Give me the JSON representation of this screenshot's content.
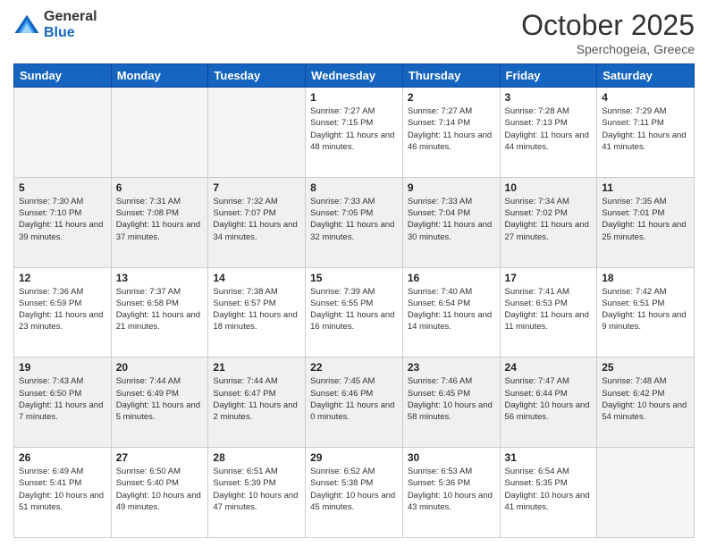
{
  "header": {
    "logo_general": "General",
    "logo_blue": "Blue",
    "month_title": "October 2025",
    "location": "Sperchogeia, Greece"
  },
  "days_of_week": [
    "Sunday",
    "Monday",
    "Tuesday",
    "Wednesday",
    "Thursday",
    "Friday",
    "Saturday"
  ],
  "weeks": [
    [
      {
        "day": "",
        "empty": true
      },
      {
        "day": "",
        "empty": true
      },
      {
        "day": "",
        "empty": true
      },
      {
        "day": "1",
        "sunrise": "7:27 AM",
        "sunset": "7:15 PM",
        "daylight": "11 hours and 48 minutes."
      },
      {
        "day": "2",
        "sunrise": "7:27 AM",
        "sunset": "7:14 PM",
        "daylight": "11 hours and 46 minutes."
      },
      {
        "day": "3",
        "sunrise": "7:28 AM",
        "sunset": "7:13 PM",
        "daylight": "11 hours and 44 minutes."
      },
      {
        "day": "4",
        "sunrise": "7:29 AM",
        "sunset": "7:11 PM",
        "daylight": "11 hours and 41 minutes."
      }
    ],
    [
      {
        "day": "5",
        "sunrise": "7:30 AM",
        "sunset": "7:10 PM",
        "daylight": "11 hours and 39 minutes."
      },
      {
        "day": "6",
        "sunrise": "7:31 AM",
        "sunset": "7:08 PM",
        "daylight": "11 hours and 37 minutes."
      },
      {
        "day": "7",
        "sunrise": "7:32 AM",
        "sunset": "7:07 PM",
        "daylight": "11 hours and 34 minutes."
      },
      {
        "day": "8",
        "sunrise": "7:33 AM",
        "sunset": "7:05 PM",
        "daylight": "11 hours and 32 minutes."
      },
      {
        "day": "9",
        "sunrise": "7:33 AM",
        "sunset": "7:04 PM",
        "daylight": "11 hours and 30 minutes."
      },
      {
        "day": "10",
        "sunrise": "7:34 AM",
        "sunset": "7:02 PM",
        "daylight": "11 hours and 27 minutes."
      },
      {
        "day": "11",
        "sunrise": "7:35 AM",
        "sunset": "7:01 PM",
        "daylight": "11 hours and 25 minutes."
      }
    ],
    [
      {
        "day": "12",
        "sunrise": "7:36 AM",
        "sunset": "6:59 PM",
        "daylight": "11 hours and 23 minutes."
      },
      {
        "day": "13",
        "sunrise": "7:37 AM",
        "sunset": "6:58 PM",
        "daylight": "11 hours and 21 minutes."
      },
      {
        "day": "14",
        "sunrise": "7:38 AM",
        "sunset": "6:57 PM",
        "daylight": "11 hours and 18 minutes."
      },
      {
        "day": "15",
        "sunrise": "7:39 AM",
        "sunset": "6:55 PM",
        "daylight": "11 hours and 16 minutes."
      },
      {
        "day": "16",
        "sunrise": "7:40 AM",
        "sunset": "6:54 PM",
        "daylight": "11 hours and 14 minutes."
      },
      {
        "day": "17",
        "sunrise": "7:41 AM",
        "sunset": "6:53 PM",
        "daylight": "11 hours and 11 minutes."
      },
      {
        "day": "18",
        "sunrise": "7:42 AM",
        "sunset": "6:51 PM",
        "daylight": "11 hours and 9 minutes."
      }
    ],
    [
      {
        "day": "19",
        "sunrise": "7:43 AM",
        "sunset": "6:50 PM",
        "daylight": "11 hours and 7 minutes."
      },
      {
        "day": "20",
        "sunrise": "7:44 AM",
        "sunset": "6:49 PM",
        "daylight": "11 hours and 5 minutes."
      },
      {
        "day": "21",
        "sunrise": "7:44 AM",
        "sunset": "6:47 PM",
        "daylight": "11 hours and 2 minutes."
      },
      {
        "day": "22",
        "sunrise": "7:45 AM",
        "sunset": "6:46 PM",
        "daylight": "11 hours and 0 minutes."
      },
      {
        "day": "23",
        "sunrise": "7:46 AM",
        "sunset": "6:45 PM",
        "daylight": "10 hours and 58 minutes."
      },
      {
        "day": "24",
        "sunrise": "7:47 AM",
        "sunset": "6:44 PM",
        "daylight": "10 hours and 56 minutes."
      },
      {
        "day": "25",
        "sunrise": "7:48 AM",
        "sunset": "6:42 PM",
        "daylight": "10 hours and 54 minutes."
      }
    ],
    [
      {
        "day": "26",
        "sunrise": "6:49 AM",
        "sunset": "5:41 PM",
        "daylight": "10 hours and 51 minutes."
      },
      {
        "day": "27",
        "sunrise": "6:50 AM",
        "sunset": "5:40 PM",
        "daylight": "10 hours and 49 minutes."
      },
      {
        "day": "28",
        "sunrise": "6:51 AM",
        "sunset": "5:39 PM",
        "daylight": "10 hours and 47 minutes."
      },
      {
        "day": "29",
        "sunrise": "6:52 AM",
        "sunset": "5:38 PM",
        "daylight": "10 hours and 45 minutes."
      },
      {
        "day": "30",
        "sunrise": "6:53 AM",
        "sunset": "5:36 PM",
        "daylight": "10 hours and 43 minutes."
      },
      {
        "day": "31",
        "sunrise": "6:54 AM",
        "sunset": "5:35 PM",
        "daylight": "10 hours and 41 minutes."
      },
      {
        "day": "",
        "empty": true
      }
    ]
  ]
}
